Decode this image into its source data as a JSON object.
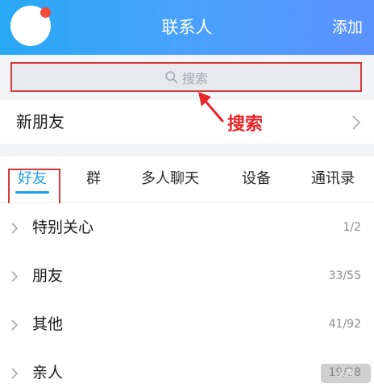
{
  "header": {
    "title": "联系人",
    "add_label": "添加",
    "avatar_icon": "avatar",
    "notification_dot_color": "#f04a3a"
  },
  "search": {
    "placeholder": "搜索",
    "icon": "search-icon"
  },
  "annotation": {
    "label": "搜索",
    "color": "#e8262a"
  },
  "new_friends": {
    "label": "新朋友",
    "icon": "chevron-right-icon"
  },
  "tabs": [
    {
      "label": "好友",
      "active": true
    },
    {
      "label": "群",
      "active": false
    },
    {
      "label": "多人聊天",
      "active": false
    },
    {
      "label": "设备",
      "active": false
    },
    {
      "label": "通讯录",
      "active": false
    }
  ],
  "accent_color": "#1aa0ea",
  "groups": [
    {
      "name": "特别关心",
      "count": "1/2"
    },
    {
      "name": "朋友",
      "count": "33/55"
    },
    {
      "name": "其他",
      "count": "41/92"
    },
    {
      "name": "亲人",
      "count": "19/28"
    }
  ]
}
